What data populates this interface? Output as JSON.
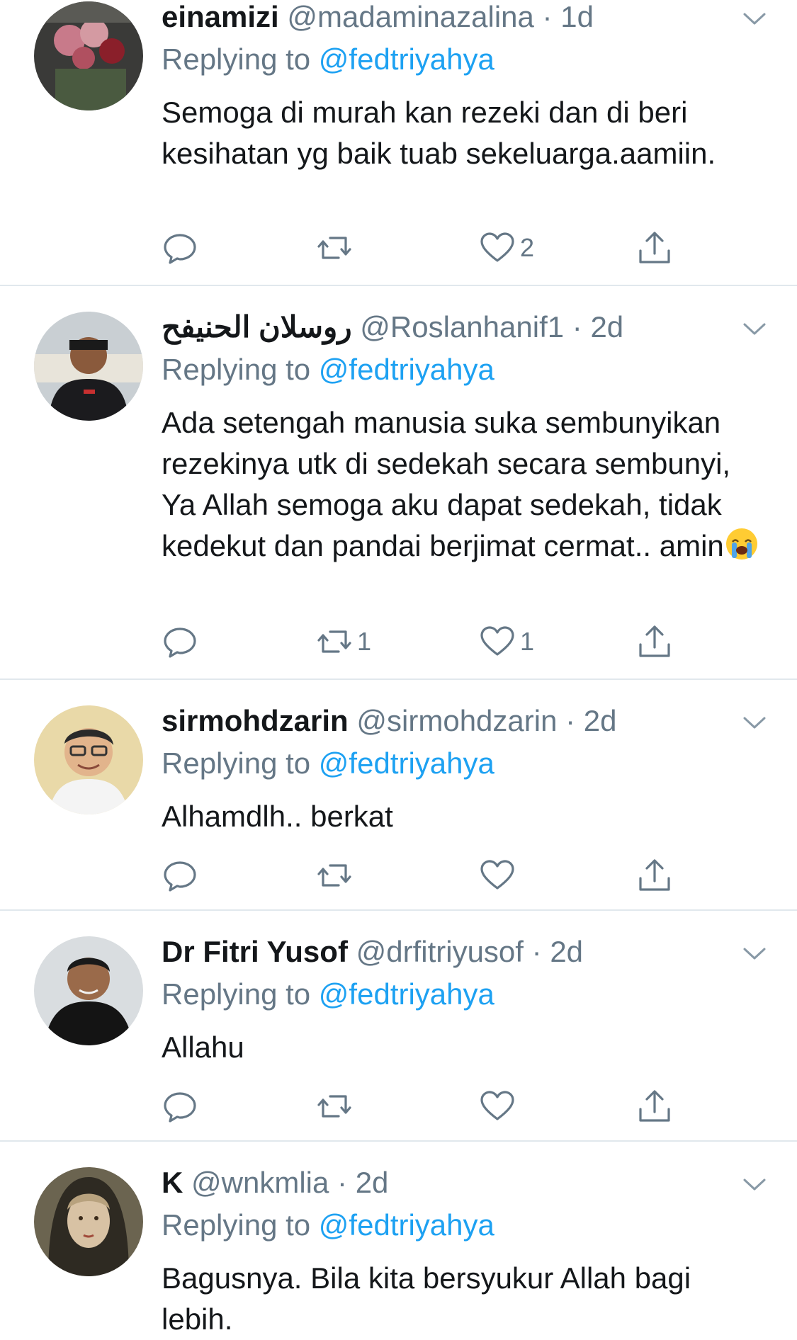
{
  "tweets": [
    {
      "name": "einamizi",
      "handle": "@madaminazalina",
      "dot": "·",
      "time": "1d",
      "replying_prefix": "Replying to",
      "replying_to": "@fedtriyahya",
      "text": "Semoga di murah kan rezeki dan di beri kesihatan yg baik tuab sekeluarga.aamiin.",
      "reply_count": "",
      "retweet_count": "",
      "like_count": "2"
    },
    {
      "name": "روسلان الحنيفح",
      "handle": "@Roslanhanif1",
      "dot": "·",
      "time": "2d",
      "replying_prefix": "Replying to",
      "replying_to": "@fedtriyahya",
      "text": "Ada setengah manusia suka sembunyikan rezekinya utk di sedekah secara sembunyi, Ya Allah semoga aku dapat sedekah, tidak kedekut dan pandai berjimat cermat.. amin",
      "reply_count": "",
      "retweet_count": "1",
      "like_count": "1"
    },
    {
      "name": "sirmohdzarin",
      "handle": "@sirmohdzarin",
      "dot": "·",
      "time": "2d",
      "replying_prefix": "Replying to",
      "replying_to": "@fedtriyahya",
      "text": "Alhamdlh.. berkat",
      "reply_count": "",
      "retweet_count": "",
      "like_count": ""
    },
    {
      "name": "Dr Fitri Yusof",
      "handle": "@drfitriyusof",
      "dot": "·",
      "time": "2d",
      "replying_prefix": "Replying to",
      "replying_to": "@fedtriyahya",
      "text": "Allahu",
      "reply_count": "",
      "retweet_count": "",
      "like_count": ""
    },
    {
      "name": "K",
      "handle": "@wnkmlia",
      "dot": "·",
      "time": "2d",
      "replying_prefix": "Replying to",
      "replying_to": "@fedtriyahya",
      "text": "Bagusnya. Bila kita bersyukur Allah bagi lebih.",
      "reply_count": "",
      "retweet_count": "",
      "like_count": ""
    }
  ],
  "icons": {
    "reply": "reply-icon",
    "retweet": "retweet-icon",
    "like": "heart-icon",
    "share": "share-icon",
    "more": "chevron-down-icon",
    "emoji": "crying-face-emoji"
  },
  "colors": {
    "text": "#14171a",
    "secondary": "#657786",
    "link": "#1da1f2",
    "divider": "#e1e8ed"
  }
}
